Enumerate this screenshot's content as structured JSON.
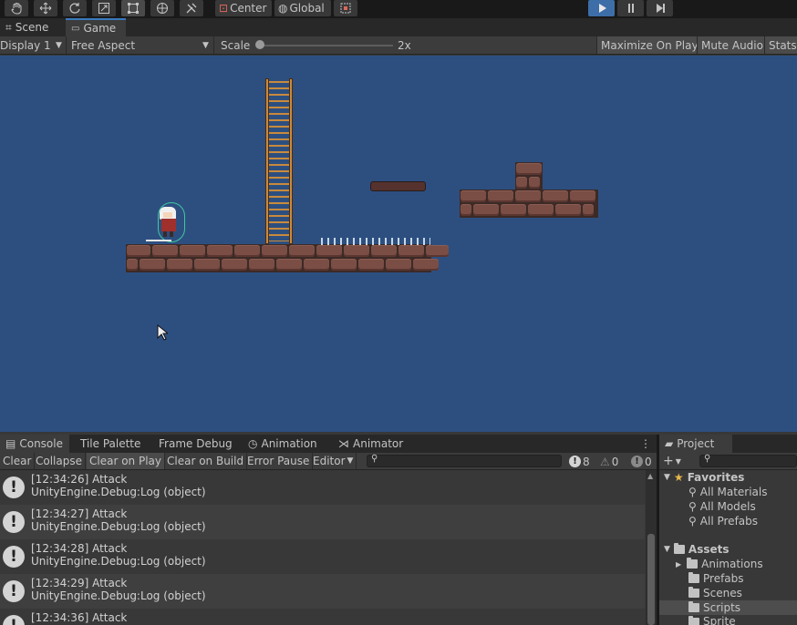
{
  "toolbar": {
    "pivot_label": "Center",
    "space_label": "Global",
    "tools": [
      "hand-tool",
      "move-tool",
      "rotate-tool",
      "scale-tool",
      "rect-tool",
      "transform-tool",
      "custom-tool"
    ]
  },
  "tabs": {
    "scene": "Scene",
    "game": "Game"
  },
  "game_toolbar": {
    "display": "Display 1",
    "aspect": "Free Aspect",
    "scale_label": "Scale",
    "scale_value": "2x",
    "maximize": "Maximize On Play",
    "mute": "Mute Audio",
    "stats": "Stats"
  },
  "console": {
    "tabs": [
      "Console",
      "Tile Palette",
      "Frame Debug",
      "Animation",
      "Animator"
    ],
    "toolbar": {
      "clear": "Clear",
      "collapse": "Collapse",
      "clear_on_play": "Clear on Play",
      "clear_on_build": "Clear on Build",
      "error_pause": "Error Pause",
      "editor": "Editor",
      "search_placeholder": "",
      "log_count": "8",
      "warn_count": "0",
      "error_count": "0"
    },
    "logs": [
      {
        "line1": "[12:34:26] Attack",
        "line2": "UnityEngine.Debug:Log (object)"
      },
      {
        "line1": "[12:34:27] Attack",
        "line2": "UnityEngine.Debug:Log (object)"
      },
      {
        "line1": "[12:34:28] Attack",
        "line2": "UnityEngine.Debug:Log (object)"
      },
      {
        "line1": "[12:34:29] Attack",
        "line2": "UnityEngine.Debug:Log (object)"
      },
      {
        "line1": "[12:34:36] Attack",
        "line2": ""
      }
    ]
  },
  "project": {
    "tab": "Project",
    "favorites_label": "Favorites",
    "favorites": [
      "All Materials",
      "All Models",
      "All Prefabs"
    ],
    "assets_label": "Assets",
    "folders": [
      "Animations",
      "Prefabs",
      "Scenes",
      "Scripts",
      "Sprite"
    ]
  },
  "colors": {
    "game_bg": "#2d4f80",
    "brick": "#7a4e45",
    "ladder": "#c98a3d",
    "play_active": "#3e6ea8"
  }
}
